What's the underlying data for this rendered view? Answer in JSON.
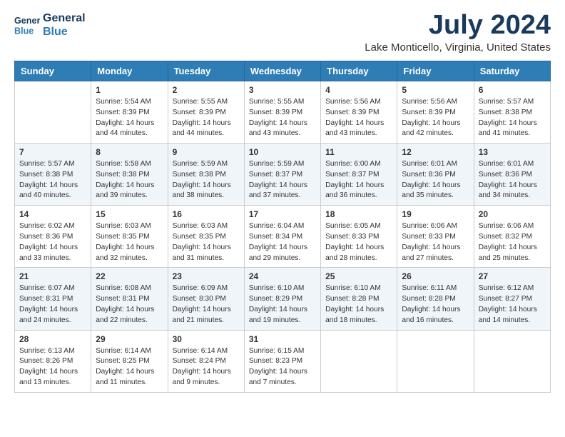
{
  "header": {
    "logo_line1": "General",
    "logo_line2": "Blue",
    "month": "July 2024",
    "location": "Lake Monticello, Virginia, United States"
  },
  "weekdays": [
    "Sunday",
    "Monday",
    "Tuesday",
    "Wednesday",
    "Thursday",
    "Friday",
    "Saturday"
  ],
  "weeks": [
    [
      {
        "day": "",
        "info": ""
      },
      {
        "day": "1",
        "info": "Sunrise: 5:54 AM\nSunset: 8:39 PM\nDaylight: 14 hours\nand 44 minutes."
      },
      {
        "day": "2",
        "info": "Sunrise: 5:55 AM\nSunset: 8:39 PM\nDaylight: 14 hours\nand 44 minutes."
      },
      {
        "day": "3",
        "info": "Sunrise: 5:55 AM\nSunset: 8:39 PM\nDaylight: 14 hours\nand 43 minutes."
      },
      {
        "day": "4",
        "info": "Sunrise: 5:56 AM\nSunset: 8:39 PM\nDaylight: 14 hours\nand 43 minutes."
      },
      {
        "day": "5",
        "info": "Sunrise: 5:56 AM\nSunset: 8:39 PM\nDaylight: 14 hours\nand 42 minutes."
      },
      {
        "day": "6",
        "info": "Sunrise: 5:57 AM\nSunset: 8:38 PM\nDaylight: 14 hours\nand 41 minutes."
      }
    ],
    [
      {
        "day": "7",
        "info": "Sunrise: 5:57 AM\nSunset: 8:38 PM\nDaylight: 14 hours\nand 40 minutes."
      },
      {
        "day": "8",
        "info": "Sunrise: 5:58 AM\nSunset: 8:38 PM\nDaylight: 14 hours\nand 39 minutes."
      },
      {
        "day": "9",
        "info": "Sunrise: 5:59 AM\nSunset: 8:38 PM\nDaylight: 14 hours\nand 38 minutes."
      },
      {
        "day": "10",
        "info": "Sunrise: 5:59 AM\nSunset: 8:37 PM\nDaylight: 14 hours\nand 37 minutes."
      },
      {
        "day": "11",
        "info": "Sunrise: 6:00 AM\nSunset: 8:37 PM\nDaylight: 14 hours\nand 36 minutes."
      },
      {
        "day": "12",
        "info": "Sunrise: 6:01 AM\nSunset: 8:36 PM\nDaylight: 14 hours\nand 35 minutes."
      },
      {
        "day": "13",
        "info": "Sunrise: 6:01 AM\nSunset: 8:36 PM\nDaylight: 14 hours\nand 34 minutes."
      }
    ],
    [
      {
        "day": "14",
        "info": "Sunrise: 6:02 AM\nSunset: 8:36 PM\nDaylight: 14 hours\nand 33 minutes."
      },
      {
        "day": "15",
        "info": "Sunrise: 6:03 AM\nSunset: 8:35 PM\nDaylight: 14 hours\nand 32 minutes."
      },
      {
        "day": "16",
        "info": "Sunrise: 6:03 AM\nSunset: 8:35 PM\nDaylight: 14 hours\nand 31 minutes."
      },
      {
        "day": "17",
        "info": "Sunrise: 6:04 AM\nSunset: 8:34 PM\nDaylight: 14 hours\nand 29 minutes."
      },
      {
        "day": "18",
        "info": "Sunrise: 6:05 AM\nSunset: 8:33 PM\nDaylight: 14 hours\nand 28 minutes."
      },
      {
        "day": "19",
        "info": "Sunrise: 6:06 AM\nSunset: 8:33 PM\nDaylight: 14 hours\nand 27 minutes."
      },
      {
        "day": "20",
        "info": "Sunrise: 6:06 AM\nSunset: 8:32 PM\nDaylight: 14 hours\nand 25 minutes."
      }
    ],
    [
      {
        "day": "21",
        "info": "Sunrise: 6:07 AM\nSunset: 8:31 PM\nDaylight: 14 hours\nand 24 minutes."
      },
      {
        "day": "22",
        "info": "Sunrise: 6:08 AM\nSunset: 8:31 PM\nDaylight: 14 hours\nand 22 minutes."
      },
      {
        "day": "23",
        "info": "Sunrise: 6:09 AM\nSunset: 8:30 PM\nDaylight: 14 hours\nand 21 minutes."
      },
      {
        "day": "24",
        "info": "Sunrise: 6:10 AM\nSunset: 8:29 PM\nDaylight: 14 hours\nand 19 minutes."
      },
      {
        "day": "25",
        "info": "Sunrise: 6:10 AM\nSunset: 8:28 PM\nDaylight: 14 hours\nand 18 minutes."
      },
      {
        "day": "26",
        "info": "Sunrise: 6:11 AM\nSunset: 8:28 PM\nDaylight: 14 hours\nand 16 minutes."
      },
      {
        "day": "27",
        "info": "Sunrise: 6:12 AM\nSunset: 8:27 PM\nDaylight: 14 hours\nand 14 minutes."
      }
    ],
    [
      {
        "day": "28",
        "info": "Sunrise: 6:13 AM\nSunset: 8:26 PM\nDaylight: 14 hours\nand 13 minutes."
      },
      {
        "day": "29",
        "info": "Sunrise: 6:14 AM\nSunset: 8:25 PM\nDaylight: 14 hours\nand 11 minutes."
      },
      {
        "day": "30",
        "info": "Sunrise: 6:14 AM\nSunset: 8:24 PM\nDaylight: 14 hours\nand 9 minutes."
      },
      {
        "day": "31",
        "info": "Sunrise: 6:15 AM\nSunset: 8:23 PM\nDaylight: 14 hours\nand 7 minutes."
      },
      {
        "day": "",
        "info": ""
      },
      {
        "day": "",
        "info": ""
      },
      {
        "day": "",
        "info": ""
      }
    ]
  ]
}
